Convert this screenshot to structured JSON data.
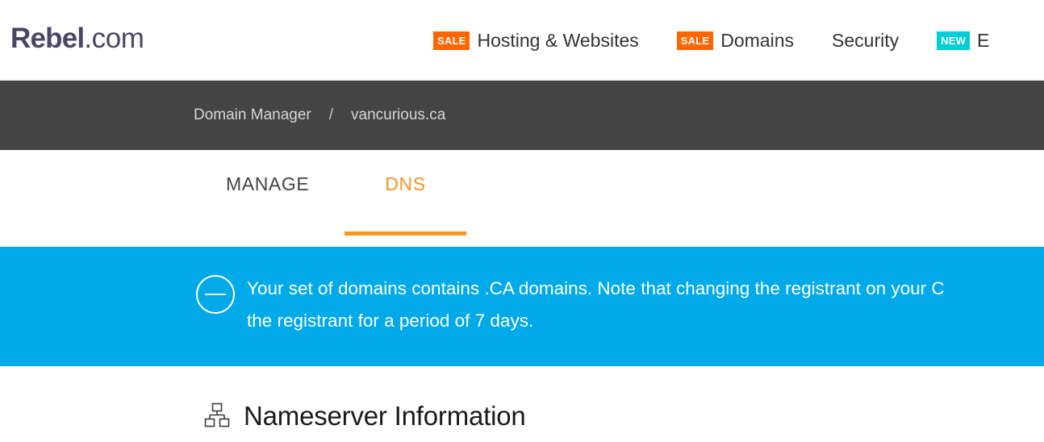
{
  "header": {
    "logo": {
      "strong": "Rebel",
      "tld": ".com"
    },
    "nav": [
      {
        "badge": "SALE",
        "badge_kind": "sale",
        "label": "Hosting & Websites"
      },
      {
        "badge": "SALE",
        "badge_kind": "sale",
        "label": "Domains"
      },
      {
        "badge": "",
        "badge_kind": "none",
        "label": "Security"
      },
      {
        "badge": "NEW",
        "badge_kind": "new",
        "label": "E"
      }
    ]
  },
  "breadcrumb": {
    "root": "Domain Manager",
    "separator": "/",
    "current": "vancurious.ca"
  },
  "tabs": [
    {
      "label": "MANAGE",
      "active": false
    },
    {
      "label": "DNS",
      "active": true
    }
  ],
  "notice": {
    "icon": "minus-circle-icon",
    "line1": "Your set of domains contains .CA domains. Note that changing the registrant on your C",
    "line2": "the registrant for a period of 7 days."
  },
  "section": {
    "icon": "sitemap-icon",
    "title": "Nameserver Information"
  },
  "colors": {
    "brand": "#4b4666",
    "accent_orange": "#f7941e",
    "badge_sale": "#ff6600",
    "badge_new": "#00cfd6",
    "banner_blue": "#00a9e8",
    "breadcrumb_bar": "#444444"
  }
}
